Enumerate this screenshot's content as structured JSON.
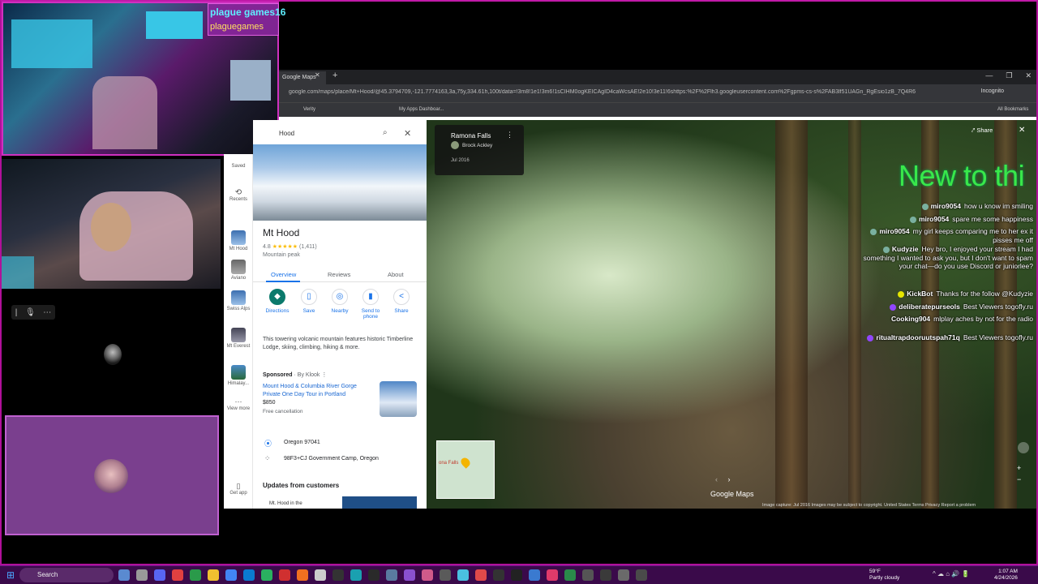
{
  "overlay": {
    "cam_name_line1": "plague games16",
    "cam_name_line2": "plaguegames",
    "new_to": "New to thi"
  },
  "browser": {
    "tab_title": "Google Maps",
    "url": "google.com/maps/place/Mt+Hood/@45.3794709,-121.7774163,3a,75y,334.61h,100t/data=!3m8!1e1!3m6!1sCIHM0ogKEICAgID4caWcsAE!2e10!3e11!6shttps:%2F%2Flh3.googleusercontent.com%2Fgpms-cs-s%2FAB3lf51UAGn_RgEsio1zB_7Q4R6",
    "incognito": "Incognito",
    "bookmarks": [
      "Verity",
      "My Apps Dashboar...",
      "All Bookmarks"
    ]
  },
  "rail": [
    {
      "label": "Saved"
    },
    {
      "label": "Recents"
    },
    {
      "label": "Mt Hood"
    },
    {
      "label": "Aviano"
    },
    {
      "label": "Swiss Alps"
    },
    {
      "label": "Mt Everest"
    },
    {
      "label": "Himalay..."
    },
    {
      "label": "View more"
    },
    {
      "label": "Get app"
    }
  ],
  "panel": {
    "search_text": "Hood",
    "title": "Mt Hood",
    "rating": "4.8",
    "stars": "★★★★★",
    "reviews": "(1,411)",
    "type": "Mountain peak",
    "tabs": [
      "Overview",
      "Reviews",
      "About"
    ],
    "actions": [
      "Directions",
      "Save",
      "Nearby",
      "Send to phone",
      "Share"
    ],
    "description": "This towering volcanic mountain features historic Timberline Lodge, skiing, climbing, hiking & more.",
    "sponsored": "Sponsored",
    "sponsored_by": "· By Klook ⋮",
    "ad_title": "Mount Hood & Columbia River Gorge Private One Day Tour in Portland",
    "ad_price": "$850",
    "ad_cancel": "Free cancellation",
    "address1": "Oregon 97041",
    "address2": "98F3+CJ Government Camp, Oregon",
    "updates_title": "Updates from customers",
    "updates_preview": "Mt. Hood in the"
  },
  "streetview": {
    "title": "Ramona Falls",
    "author": "Brock Ackley",
    "date": "Jul 2016",
    "share": "Share",
    "logo": "Google Maps",
    "minimap_label": "ona Falls",
    "footer": "Image capture: Jul 2016    Images may be subject to copyright.    United States    Terms    Privacy    Report a problem"
  },
  "chat": [
    {
      "user": "miro9054",
      "text": "how u know im smiling"
    },
    {
      "user": "miro9054",
      "text": "spare me some happiness"
    },
    {
      "user": "miro9054",
      "text": "my girl keeps comparing me to her ex it pisses me off"
    },
    {
      "user": "Kudyzie",
      "text": "Hey bro, I enjoyed your stream I had something I wanted to ask you, but I don't want to spam your chat—do you use Discord or juniorlee?"
    },
    {
      "user": "KickBot",
      "text": "Thanks for the follow @Kudyzie"
    },
    {
      "user": "deliberatepurseols",
      "text": "Best Viewers togofly.ru"
    },
    {
      "user": "Cooking904",
      "text": "mlplay aches by not for the radio"
    },
    {
      "user": "ritualtrapdooruutspah71q",
      "text": "Best Viewers togofly.ru"
    }
  ],
  "taskbar": {
    "search": "Search",
    "weather_temp": "59°F",
    "weather_desc": "Partly cloudy",
    "time": "1:07 AM",
    "date": "4/24/2026"
  }
}
